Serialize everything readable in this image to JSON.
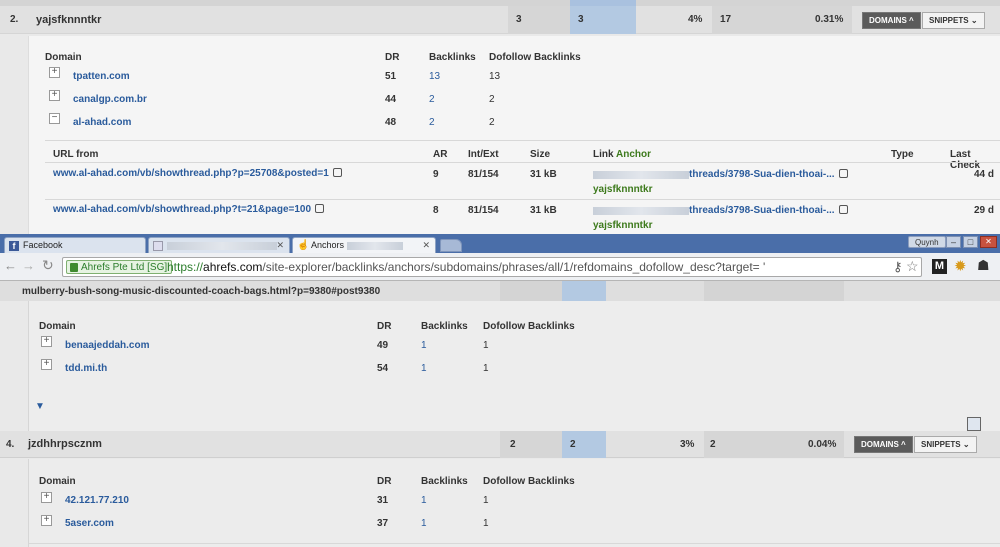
{
  "section1": {
    "row_number": "2.",
    "keyword": "yajsfknnntkr",
    "referring_domains": "3",
    "dofollow_domains": "3",
    "domains_pct": "4%",
    "backlinks": "17",
    "backlinks_pct": "0.31%",
    "domains_button": "DOMAINS",
    "snippets_button": "SNIPPETS",
    "domain_headers": {
      "domain": "Domain",
      "dr": "DR",
      "backlinks": "Backlinks",
      "dofollow": "Dofollow Backlinks"
    },
    "domains": [
      {
        "domain": "tpatten.com",
        "dr": "51",
        "backlinks": "13",
        "dofollow": "13",
        "toggle": "+"
      },
      {
        "domain": "canalgp.com.br",
        "dr": "44",
        "backlinks": "2",
        "dofollow": "2",
        "toggle": "+"
      },
      {
        "domain": "al-ahad.com",
        "dr": "48",
        "backlinks": "2",
        "dofollow": "2",
        "toggle": "−"
      }
    ],
    "link_headers": {
      "url_from": "URL from",
      "ar": "AR",
      "int_ext": "Int/Ext",
      "size": "Size",
      "link": "Link",
      "anchor": "Anchor",
      "type": "Type",
      "last_check": "Last Check"
    },
    "links": [
      {
        "url": "www.al-ahad.com/vb/showthread.php?p=25708&posted=1",
        "ar": "9",
        "int": "81/",
        "ext": "154",
        "size": "31 kB",
        "link": "threads/3798-Sua-dien-thoai-...",
        "anchor": "yajsfknnntkr",
        "last_check": "44 d"
      },
      {
        "url": "www.al-ahad.com/vb/showthread.php?t=21&page=100",
        "ar": "8",
        "int": "81/",
        "ext": "154",
        "size": "31 kB",
        "link": "threads/3798-Sua-dien-thoai-...",
        "anchor": "yajsfknnntkr",
        "last_check": "29 d"
      }
    ]
  },
  "browser": {
    "tabs": [
      {
        "label": "Facebook",
        "icon": "facebook-icon"
      },
      {
        "label": "",
        "icon": "page-icon"
      },
      {
        "label": "Anchors",
        "icon": "ahrefs-icon"
      }
    ],
    "user": "Quynh",
    "ssl_label": "Ahrefs Pte Ltd [SG]",
    "url_scheme": "https://",
    "url_host": "ahrefs.com",
    "url_path": "/site-explorer/backlinks/anchors/subdomains/phrases/all/1/refdomains_dofollow_desc?target= '",
    "window_controls": [
      "–",
      "□",
      "✕"
    ]
  },
  "section2": {
    "partial_url": "mulberry-bush-song-music-discounted-coach-bags.html?p=9380#post9380",
    "domain_headers": {
      "domain": "Domain",
      "dr": "DR",
      "backlinks": "Backlinks",
      "dofollow": "Dofollow Backlinks"
    },
    "domains": [
      {
        "domain": "benaajeddah.com",
        "dr": "49",
        "backlinks": "1",
        "dofollow": "1",
        "toggle": "+"
      },
      {
        "domain": "tdd.mi.th",
        "dr": "54",
        "backlinks": "1",
        "dofollow": "1",
        "toggle": "+"
      }
    ]
  },
  "section3": {
    "row_number": "4.",
    "keyword": "jzdhhrpscznm",
    "referring_domains": "2",
    "dofollow_domains": "2",
    "domains_pct": "3%",
    "backlinks": "2",
    "backlinks_pct": "0.04%",
    "domains_button": "DOMAINS",
    "snippets_button": "SNIPPETS",
    "domain_headers": {
      "domain": "Domain",
      "dr": "DR",
      "backlinks": "Backlinks",
      "dofollow": "Dofollow Backlinks"
    },
    "domains": [
      {
        "domain": "42.121.77.210",
        "dr": "31",
        "backlinks": "1",
        "dofollow": "1",
        "toggle": "+"
      },
      {
        "domain": "5aser.com",
        "dr": "37",
        "backlinks": "1",
        "dofollow": "1",
        "toggle": "+"
      }
    ]
  }
}
